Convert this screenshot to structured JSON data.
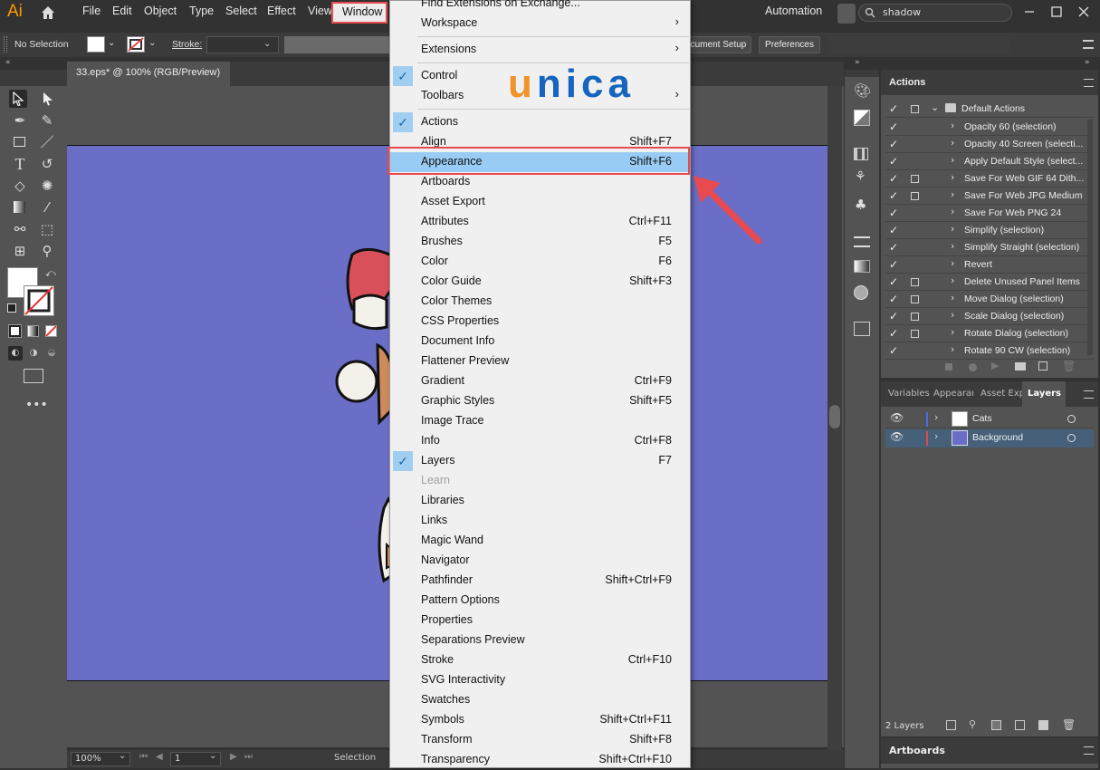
{
  "app": {
    "logo": "Ai"
  },
  "menubar": {
    "items": [
      "File",
      "Edit",
      "Object",
      "Type",
      "Select",
      "Effect",
      "View",
      "Window"
    ],
    "workspace": "Automation",
    "search_value": "shadow"
  },
  "control": {
    "selection": "No Selection",
    "stroke_label": "Stroke:",
    "doc_setup": "cument Setup",
    "preferences": "Preferences"
  },
  "doc": {
    "tab": "33.eps* @ 100% (RGB/Preview)"
  },
  "status": {
    "zoom": "100%",
    "page": "1",
    "tool": "Selection"
  },
  "watermark": {
    "text": "unica",
    "u_color": "#f0932b",
    "rest_color": "#1565c0"
  },
  "window_menu": {
    "items": [
      {
        "label": "Find Extensions on Exchange...",
        "shortcut": "",
        "checked": false,
        "submenu": false
      },
      {
        "label": "Workspace",
        "shortcut": "",
        "checked": false,
        "submenu": true
      },
      {
        "sep": true
      },
      {
        "label": "Extensions",
        "shortcut": "",
        "checked": false,
        "submenu": true
      },
      {
        "sep": true
      },
      {
        "label": "Control",
        "shortcut": "",
        "checked": true,
        "submenu": false
      },
      {
        "label": "Toolbars",
        "shortcut": "",
        "checked": false,
        "submenu": true
      },
      {
        "sep": true
      },
      {
        "label": "Actions",
        "shortcut": "",
        "checked": true,
        "submenu": false
      },
      {
        "label": "Align",
        "shortcut": "Shift+F7",
        "checked": false
      },
      {
        "label": "Appearance",
        "shortcut": "Shift+F6",
        "checked": false,
        "highlighted": true
      },
      {
        "label": "Artboards",
        "shortcut": "",
        "checked": false
      },
      {
        "label": "Asset Export",
        "shortcut": "",
        "checked": false
      },
      {
        "label": "Attributes",
        "shortcut": "Ctrl+F11",
        "checked": false
      },
      {
        "label": "Brushes",
        "shortcut": "F5",
        "checked": false
      },
      {
        "label": "Color",
        "shortcut": "F6",
        "checked": false
      },
      {
        "label": "Color Guide",
        "shortcut": "Shift+F3",
        "checked": false
      },
      {
        "label": "Color Themes",
        "shortcut": "",
        "checked": false
      },
      {
        "label": "CSS Properties",
        "shortcut": "",
        "checked": false
      },
      {
        "label": "Document Info",
        "shortcut": "",
        "checked": false
      },
      {
        "label": "Flattener Preview",
        "shortcut": "",
        "checked": false
      },
      {
        "label": "Gradient",
        "shortcut": "Ctrl+F9",
        "checked": false
      },
      {
        "label": "Graphic Styles",
        "shortcut": "Shift+F5",
        "checked": false
      },
      {
        "label": "Image Trace",
        "shortcut": "",
        "checked": false
      },
      {
        "label": "Info",
        "shortcut": "Ctrl+F8",
        "checked": false
      },
      {
        "label": "Layers",
        "shortcut": "F7",
        "checked": true
      },
      {
        "label": "Learn",
        "shortcut": "",
        "checked": false,
        "disabled": true
      },
      {
        "label": "Libraries",
        "shortcut": "",
        "checked": false
      },
      {
        "label": "Links",
        "shortcut": "",
        "checked": false
      },
      {
        "label": "Magic Wand",
        "shortcut": "",
        "checked": false
      },
      {
        "label": "Navigator",
        "shortcut": "",
        "checked": false
      },
      {
        "label": "Pathfinder",
        "shortcut": "Shift+Ctrl+F9",
        "checked": false
      },
      {
        "label": "Pattern Options",
        "shortcut": "",
        "checked": false
      },
      {
        "label": "Properties",
        "shortcut": "",
        "checked": false
      },
      {
        "label": "Separations Preview",
        "shortcut": "",
        "checked": false
      },
      {
        "label": "Stroke",
        "shortcut": "Ctrl+F10",
        "checked": false
      },
      {
        "label": "SVG Interactivity",
        "shortcut": "",
        "checked": false
      },
      {
        "label": "Swatches",
        "shortcut": "",
        "checked": false
      },
      {
        "label": "Symbols",
        "shortcut": "Shift+Ctrl+F11",
        "checked": false
      },
      {
        "label": "Transform",
        "shortcut": "Shift+F8",
        "checked": false
      },
      {
        "label": "Transparency",
        "shortcut": "Shift+Ctrl+F10",
        "checked": false
      }
    ]
  },
  "actions_panel": {
    "title": "Actions",
    "set": "Default Actions",
    "items": [
      "Opacity 60 (selection)",
      "Opacity 40 Screen (selecti...",
      "Apply Default Style (select...",
      "Save For Web GIF 64 Dith...",
      "Save For Web JPG Medium",
      "Save For Web PNG 24",
      "Simplify (selection)",
      "Simplify Straight (selection)",
      "Revert",
      "Delete Unused Panel Items",
      "Move Dialog (selection)",
      "Scale Dialog (selection)",
      "Rotate Dialog (selection)",
      "Rotate 90 CW (selection)"
    ],
    "dialog_boxes": [
      false,
      false,
      false,
      true,
      true,
      false,
      false,
      false,
      false,
      true,
      true,
      true,
      true,
      false
    ]
  },
  "layers_panel": {
    "tabs": [
      "Variables",
      "Appearar",
      "Asset Exp",
      "Layers"
    ],
    "layers": [
      {
        "name": "Cats",
        "color": "#4a6fe0"
      },
      {
        "name": "Background",
        "color": "#e04a4a"
      }
    ],
    "count": "2 Layers"
  },
  "artboards_panel": {
    "title": "Artboards"
  },
  "colors": {
    "artboard": "#6b6ec6",
    "highlight": "#e84a4f",
    "menu_hover": "#99ccf5"
  }
}
